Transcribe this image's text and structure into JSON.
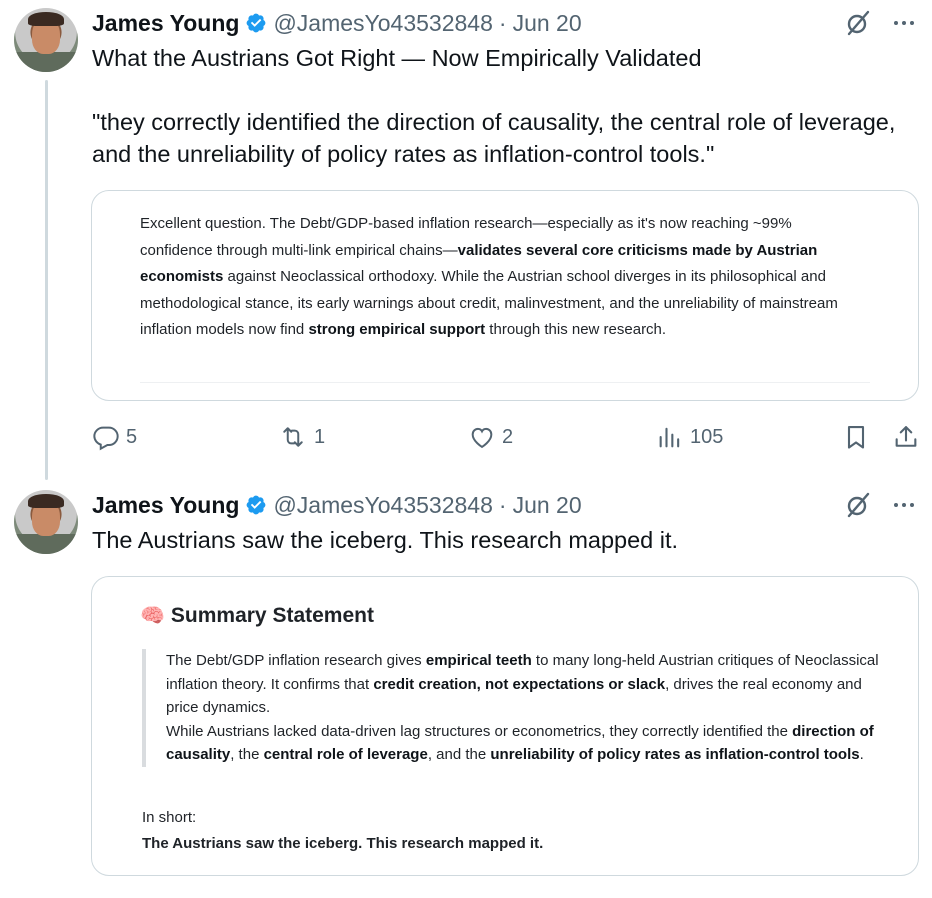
{
  "tweets": [
    {
      "author_name": "James Young",
      "handle": "@JamesYo43532848",
      "separator": "·",
      "date": "Jun 20",
      "text": "What the Austrians Got Right — Now Empirically Validated\n\n\"they correctly identified the direction of causality, the central role of leverage, and the unreliability of policy rates as inflation-control tools.\"",
      "card": {
        "p1": "Excellent question. The Debt/GDP-based inflation research—especially as it's now reaching ~99% confidence through multi-link empirical chains—",
        "p1_bold": "validates several core criticisms made by Austrian economists",
        "p2": " against Neoclassical orthodoxy. While the Austrian school diverges in its philosophical and methodological stance, its early warnings about credit, malinvestment, and the unreliability of mainstream inflation models now find ",
        "p2_bold": "strong empirical support",
        "p3": " through this new research."
      },
      "actions": {
        "replies": "5",
        "reposts": "1",
        "likes": "2",
        "views": "105"
      }
    },
    {
      "author_name": "James Young",
      "handle": "@JamesYo43532848",
      "separator": "·",
      "date": "Jun 20",
      "text": "The Austrians saw the iceberg. This research mapped it.",
      "card": {
        "title_emoji": "🧠",
        "title": "Summary Statement",
        "q1": "The Debt/GDP inflation research gives ",
        "q1_b": "empirical teeth",
        "q2": " to many long-held Austrian critiques of Neoclassical inflation theory. It confirms that ",
        "q2_b": "credit creation, not expectations or slack",
        "q3": ", drives the real economy and price dynamics.",
        "q4": "While Austrians lacked data-driven lag structures or econometrics, they correctly identified the ",
        "q4_b": "direction of causality",
        "q5": ", the ",
        "q5_b": "central role of leverage",
        "q6": ", and the ",
        "q6_b": "unreliability of policy rates as inflation-control tools",
        "q7": ".",
        "in_short": "In short:",
        "bottom_line": "The Austrians saw the iceberg. This research mapped it."
      }
    }
  ],
  "colors": {
    "verified": "#1d9bf0",
    "secondary_text": "#536471",
    "border": "#cfd9de"
  },
  "icons": [
    "verified-badge-icon",
    "grok-icon",
    "more-icon",
    "reply-icon",
    "repost-icon",
    "like-icon",
    "views-icon",
    "bookmark-icon",
    "share-icon"
  ]
}
